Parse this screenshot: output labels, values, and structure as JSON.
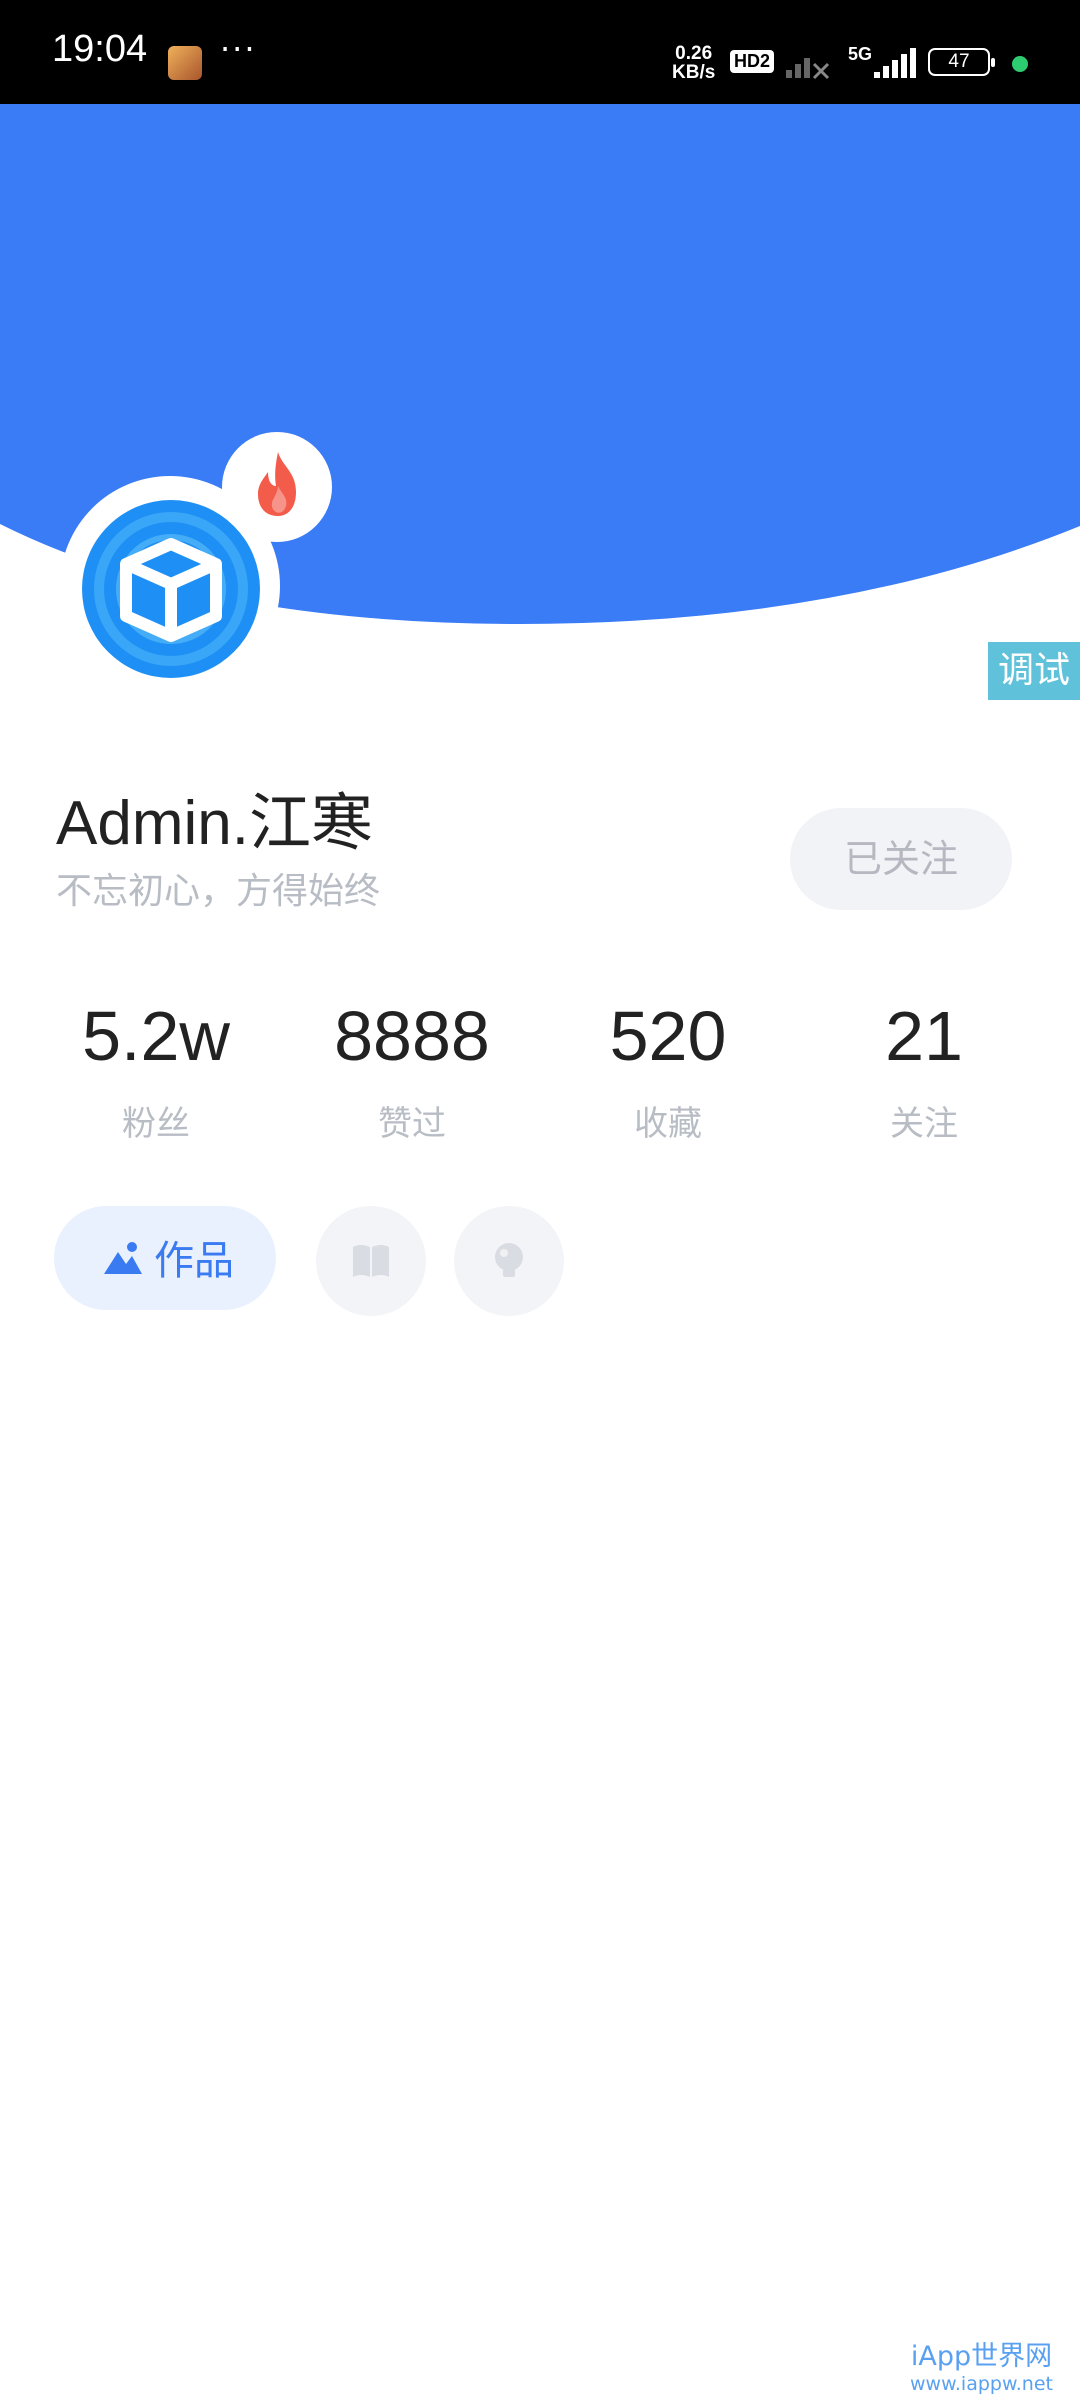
{
  "status_bar": {
    "time": "19:04",
    "more": "···",
    "net_speed_value": "0.26",
    "net_speed_unit": "KB/s",
    "hd_label": "HD2",
    "network_label": "5G",
    "battery_level": "47"
  },
  "header": {
    "background_color": "#3a7bf6"
  },
  "profile": {
    "username": "Admin.江寒",
    "motto": "不忘初心，方得始终",
    "follow_button": "已关注",
    "debug_tag": "调试"
  },
  "stats": [
    {
      "value": "5.2w",
      "label": "粉丝"
    },
    {
      "value": "8888",
      "label": "赞过"
    },
    {
      "value": "520",
      "label": "收藏"
    },
    {
      "value": "21",
      "label": "关注"
    }
  ],
  "tabs": {
    "works_label": "作品",
    "icons": [
      "mountain-icon",
      "book-icon",
      "lightbulb-icon"
    ]
  },
  "watermark": {
    "title": "iApp世界网",
    "url": "www.iappw.net"
  },
  "colors": {
    "accent": "#3a7bf6",
    "avatar": "#1e90f5",
    "fire": "#f35b4a",
    "debug": "#5fc2da"
  }
}
